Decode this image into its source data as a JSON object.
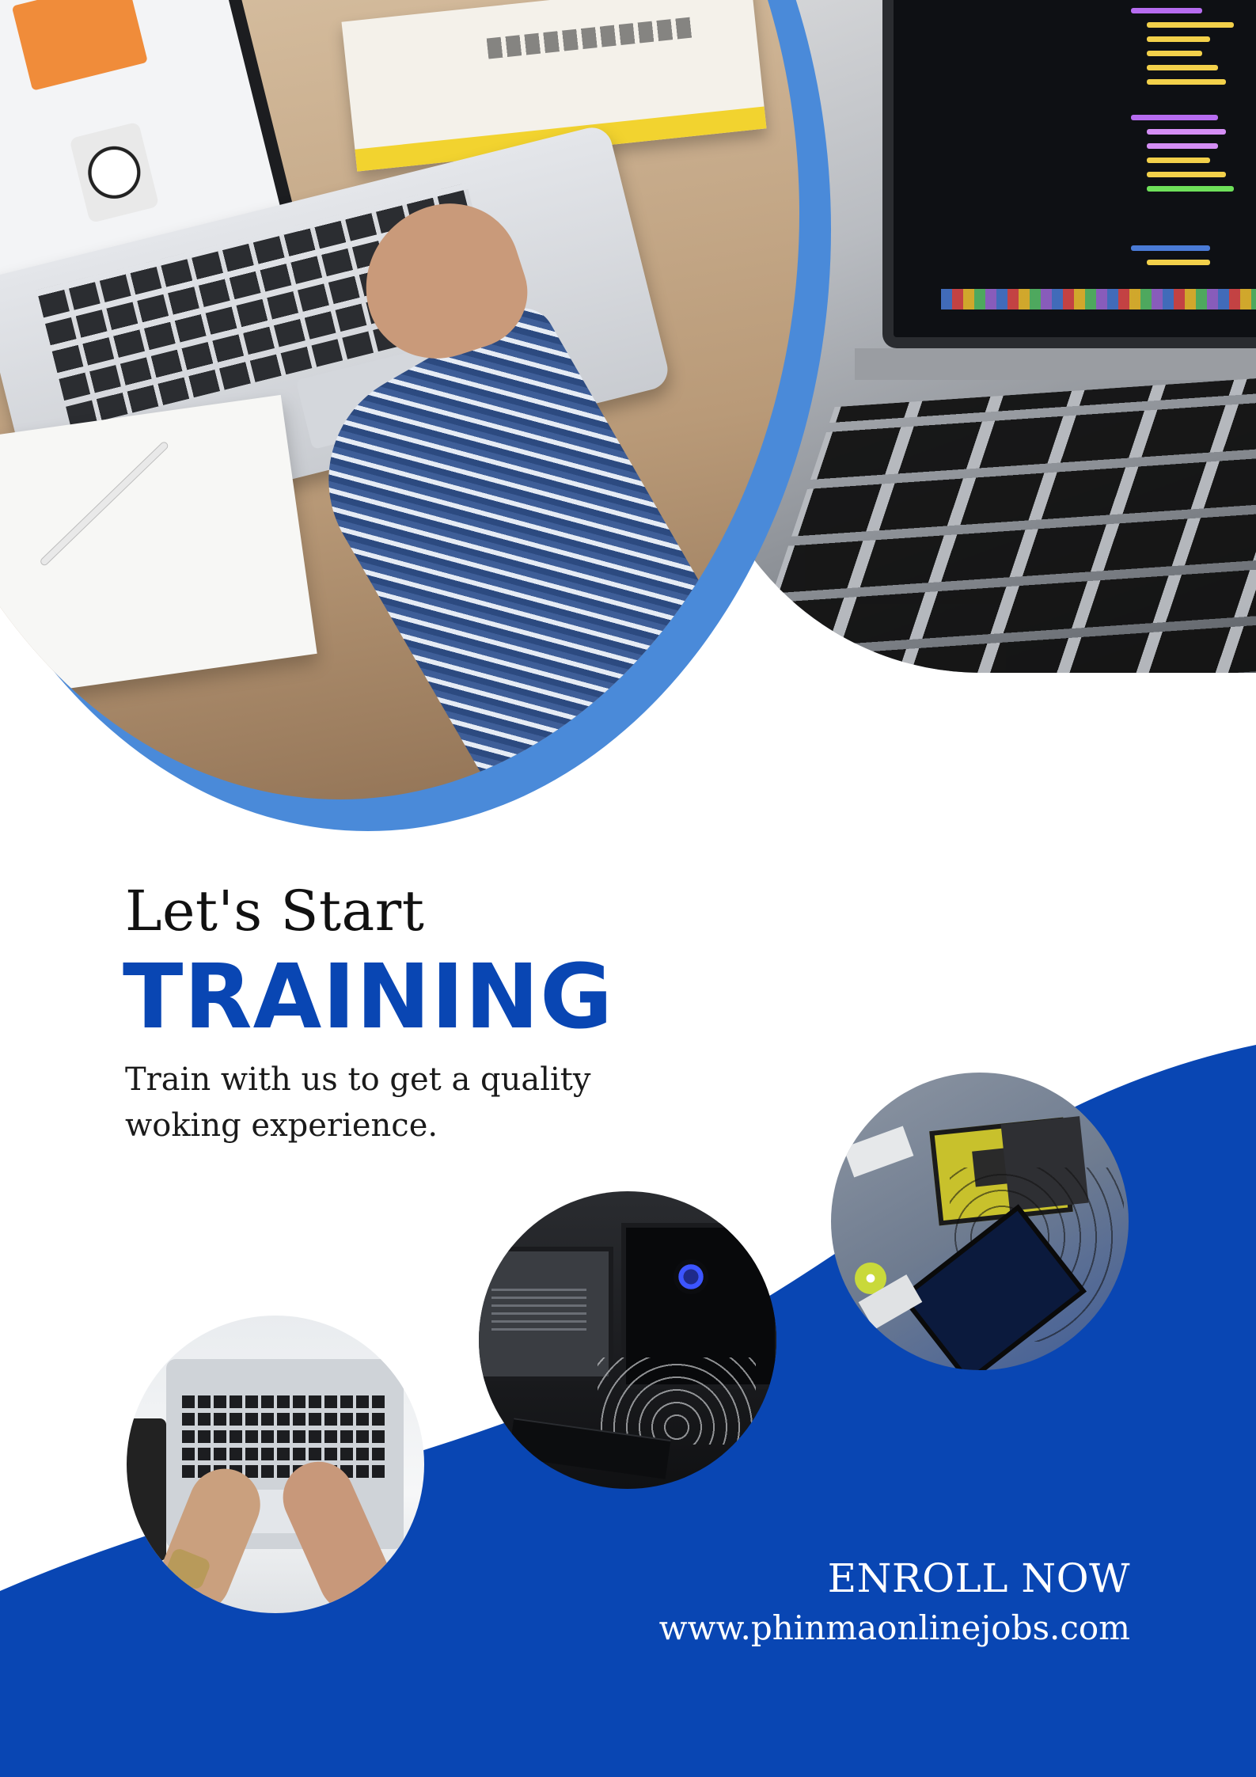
{
  "poster": {
    "heading_small": "Let's Start",
    "heading_large": "TRAINING",
    "subtitle_lines": [
      "Train with us to get a quality",
      "woking experience."
    ],
    "cta": {
      "label": "ENROLL NOW",
      "website": "www.phinmaonlinejobs.com"
    }
  },
  "photos": {
    "top_left": "laptop-on-desk-photo",
    "top_right": "laptop-keyboard-photo",
    "circle_1": "hands-typing-laptop-photo",
    "circle_2": "computer-monitors-setup-photo",
    "circle_3": "circuit-board-laptop-photo"
  },
  "colors": {
    "brand_blue": "#0946b3",
    "accent_blue": "#4a8ad9",
    "background": "#ffffff",
    "text_dark": "#111111",
    "text_light": "#ffffff"
  }
}
